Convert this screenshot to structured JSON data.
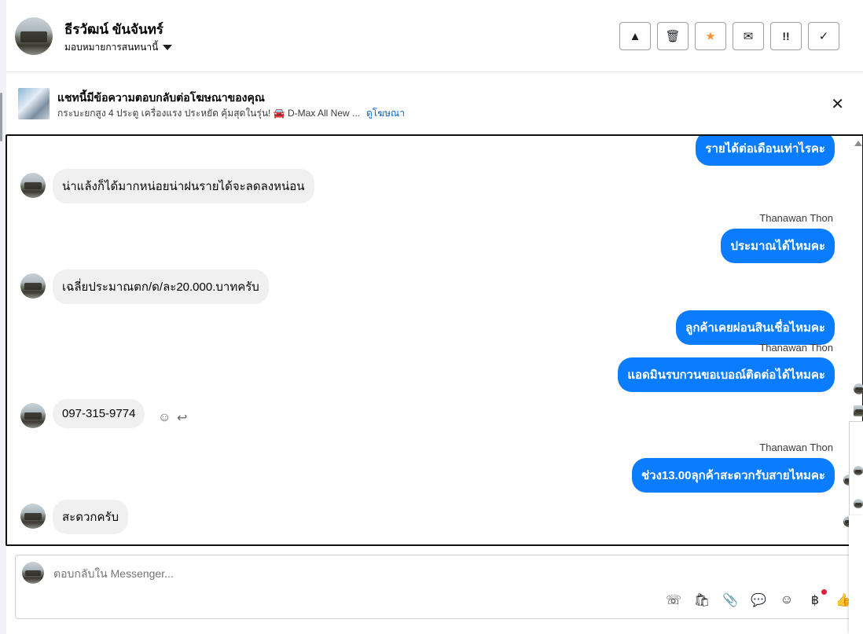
{
  "header": {
    "contact_name": "ธีรวัฒน์ ขันจันทร์",
    "assign_label": "มอบหมายการสนทนานี้",
    "tools": [
      {
        "icon": "warning-icon",
        "glyph": "▲"
      },
      {
        "icon": "trash-icon",
        "glyph": "🗑"
      },
      {
        "icon": "star-icon",
        "glyph": "★"
      },
      {
        "icon": "mail-icon",
        "glyph": "✉"
      },
      {
        "icon": "priority-icon",
        "glyph": "!!"
      },
      {
        "icon": "check-icon",
        "glyph": "✓"
      }
    ]
  },
  "ad_banner": {
    "title": "แชทนี้มีข้อความตอบกลับต่อโฆษณาของคุณ",
    "description": "กระบะยกสูง 4 ประตู เครื่องแรง ประหยัด คุ้มสุดในรุ่น! 🚘 D-Max All New ...",
    "link_label": "ดูโฆษณา",
    "close_glyph": "✕"
  },
  "messages": [
    {
      "dir": "out",
      "text": "รายได้ต่อเดือนเท่าไรคะ"
    },
    {
      "dir": "in",
      "text": "น่าแล้งก็ได้มากหน่อยน่าฝนรายได้จะลดลงหน่อน"
    },
    {
      "dir": "out",
      "sender": "Thanawan Thon",
      "text": "ประมาณได้ไหมคะ"
    },
    {
      "dir": "in",
      "text": "เฉลี่ยประมาณตก/ด/ละ20.000.บาทครับ"
    },
    {
      "dir": "out",
      "text": "ลูกค้าเคยผ่อนสินเชื่อไหมคะ"
    },
    {
      "dir": "out",
      "sender": "Thanawan Thon",
      "text": "แอดมินรบกวนขอเบอณ์ติดต่อได้ไหมคะ"
    },
    {
      "dir": "in",
      "text": "097-315-9774"
    },
    {
      "dir": "out",
      "sender": "Thanawan Thon",
      "text": "ช่วง13.00ลุกค้าสะดวกรับสายไหมคะ"
    },
    {
      "dir": "in",
      "text": "สะดวกครับ"
    }
  ],
  "composer": {
    "placeholder": "ตอบกลับใน Messenger...",
    "icons": [
      "phone-plus-icon",
      "shopping-bag-icon",
      "attachment-icon",
      "chat-bubble-icon",
      "emoji-icon",
      "baht-icon",
      "thumbs-up-icon"
    ],
    "glyphs": [
      "☏",
      "🛍",
      "📎",
      "💬",
      "☺",
      "฿",
      "👍"
    ]
  },
  "colors": {
    "outgoing": "#0a7cff",
    "incoming": "#f0f0f0",
    "link": "#0064d1",
    "star": "#f7923a"
  }
}
